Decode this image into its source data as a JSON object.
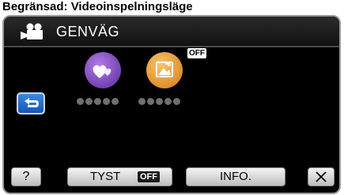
{
  "caption": "Begränsad: Videoinspelningsläge",
  "header": {
    "title": "GENVÄG",
    "mode_icon": "video-camera-icon"
  },
  "nav": {
    "back_icon": "return-arrow-icon"
  },
  "shortcuts": [
    {
      "icon": "hearts-icon",
      "color": "#7a3fb8"
    },
    {
      "icon": "image-effect-icon",
      "color": "#e8962a",
      "badge": "OFF"
    }
  ],
  "footer": {
    "help_label": "?",
    "tyst_label": "TYST",
    "tyst_state": "OFF",
    "info_label": "INFO.",
    "close_icon": "close-icon"
  },
  "colors": {
    "back_button": "#2a74d6",
    "screen_bg": "#000000"
  }
}
